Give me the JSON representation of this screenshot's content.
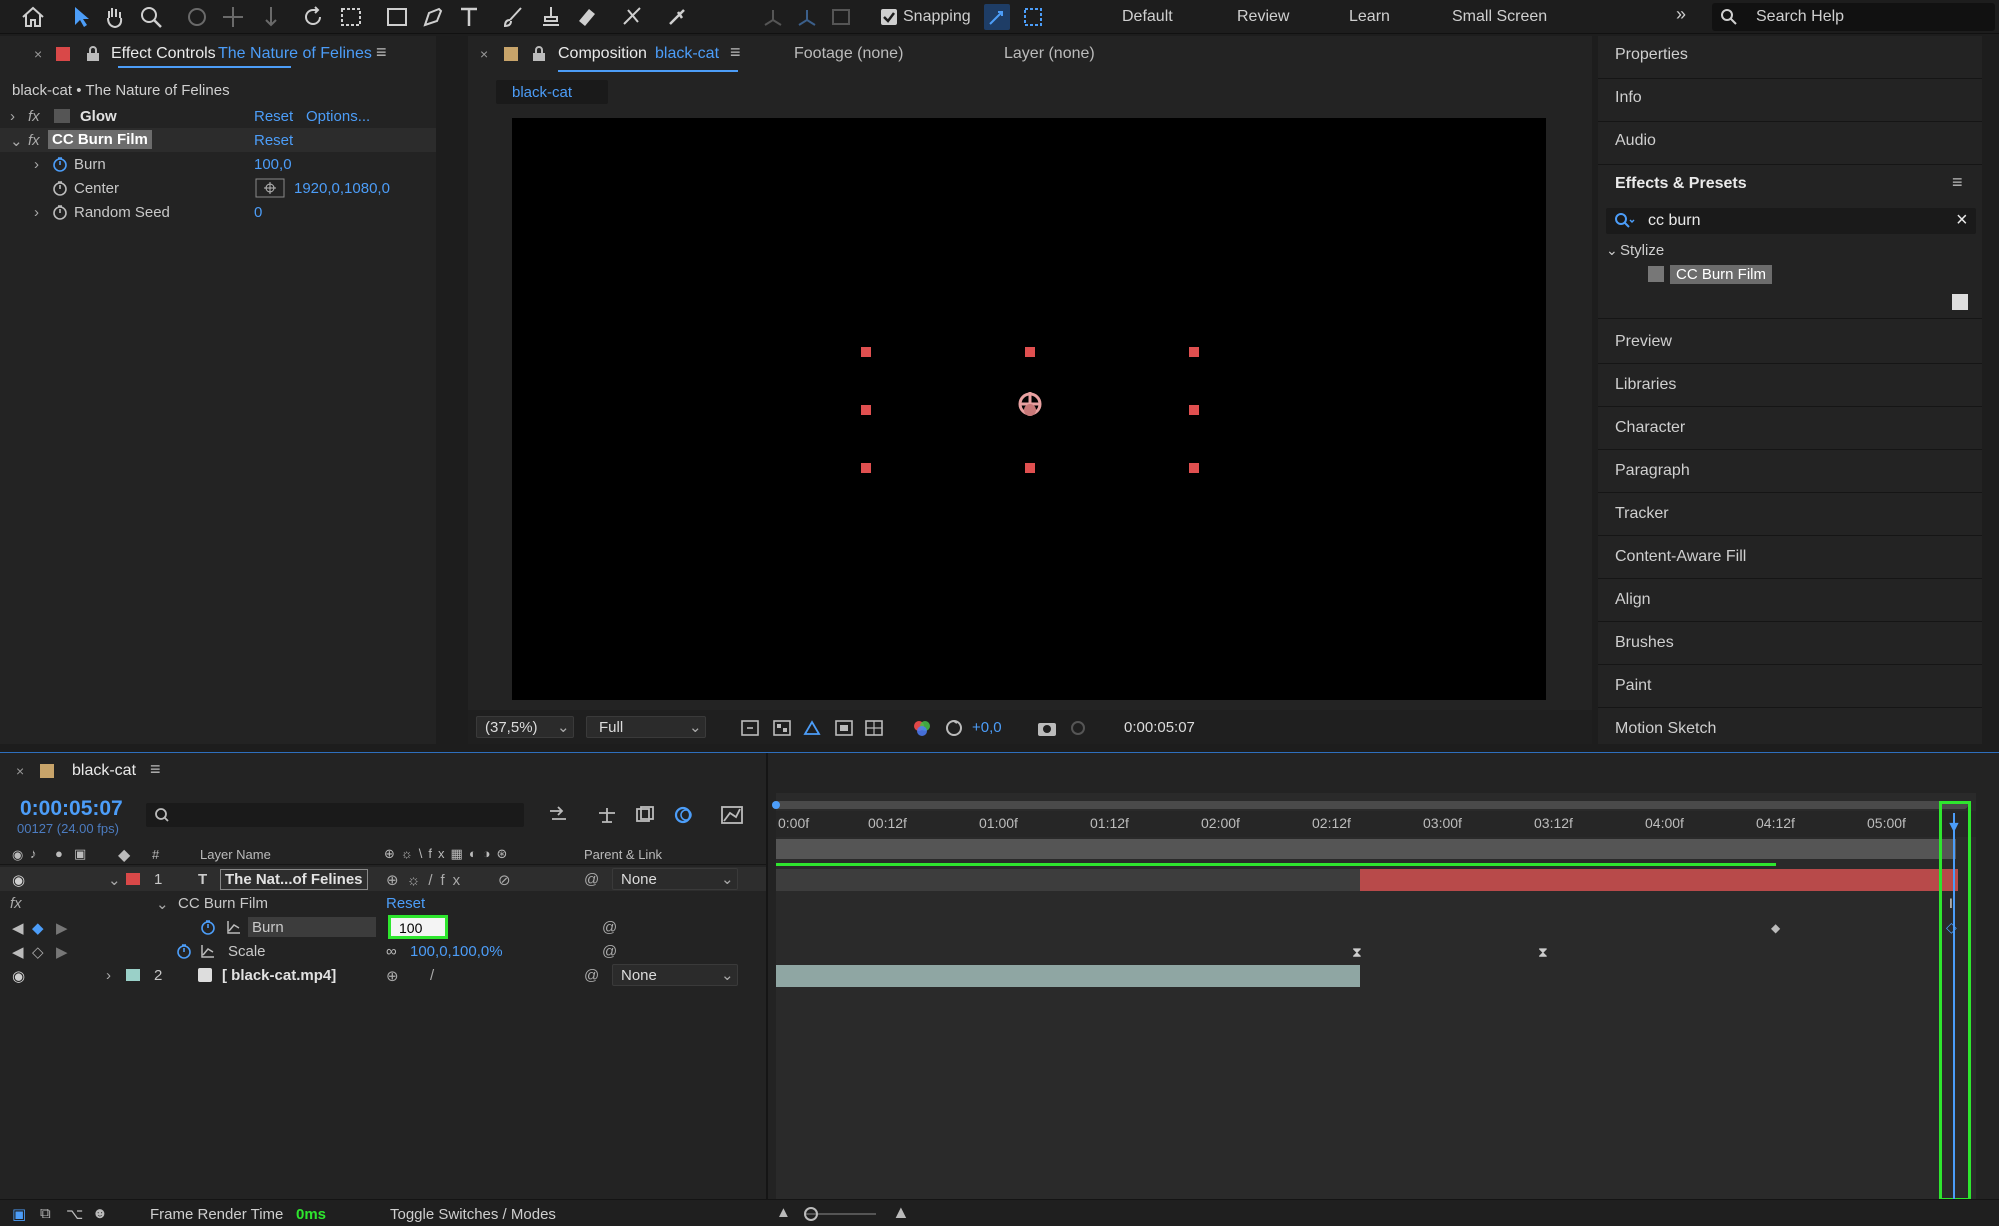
{
  "toolbar": {
    "snapping_label": "Snapping",
    "workspaces": [
      "Default",
      "Review",
      "Learn",
      "Small Screen"
    ],
    "more_label": "»",
    "search_placeholder": "Search Help"
  },
  "effect_controls": {
    "panel_title": "Effect Controls",
    "layer_name": "The Nature of Felines",
    "subtitle": "black-cat • The Nature of Felines",
    "effects": [
      {
        "name": "Glow",
        "reset": "Reset",
        "options": "Options..."
      },
      {
        "name": "CC Burn Film",
        "reset": "Reset"
      }
    ],
    "properties": [
      {
        "name": "Burn",
        "value": "100,0"
      },
      {
        "name": "Center",
        "value": "1920,0,1080,0"
      },
      {
        "name": "Random Seed",
        "value": "0"
      }
    ]
  },
  "composition": {
    "panel_title": "Composition",
    "comp_name": "black-cat",
    "footage_tab": "Footage (none)",
    "layer_tab": "Layer (none)",
    "active_tab": "black-cat",
    "zoom": "(37,5%)",
    "resolution": "Full",
    "exposure": "+0,0",
    "timecode": "0:00:05:07"
  },
  "right_panels": {
    "items_top": [
      "Properties",
      "Info",
      "Audio"
    ],
    "effects_presets": {
      "title": "Effects & Presets",
      "search_value": "cc burn",
      "category": "Stylize",
      "result": "CC Burn Film"
    },
    "items_bottom": [
      "Preview",
      "Libraries",
      "Character",
      "Paragraph",
      "Tracker",
      "Content-Aware Fill",
      "Align",
      "Brushes",
      "Paint",
      "Motion Sketch"
    ]
  },
  "timeline": {
    "comp_name": "black-cat",
    "current_time": "0:00:05:07",
    "frame_info": "00127 (24.00 fps)",
    "columns": {
      "hash": "#",
      "layer_name": "Layer Name",
      "parent_link": "Parent & Link"
    },
    "layers": [
      {
        "num": "1",
        "name": "The Nat...of Felines",
        "parent": "None",
        "label_color": "#d94848"
      },
      {
        "num": "2",
        "name": "[ black-cat.mp4]",
        "parent": "None",
        "label_color": "#9ad0c8"
      }
    ],
    "effect_group": {
      "name": "CC Burn Film",
      "reset": "Reset"
    },
    "burn": {
      "label": "Burn",
      "input_value": "100"
    },
    "scale": {
      "label": "Scale",
      "value": "100,0,100,0%"
    },
    "ruler_ticks": [
      "0:00f",
      "00:12f",
      "01:00f",
      "01:12f",
      "02:00f",
      "02:12f",
      "03:00f",
      "03:12f",
      "04:00f",
      "04:12f",
      "05:00f"
    ],
    "footer": {
      "render_label": "Frame Render Time",
      "render_value": "0ms",
      "toggle_label": "Toggle Switches / Modes"
    },
    "colors": {
      "accent": "#4c9df8",
      "highlight": "#2ee62e",
      "layer1_bar": "#b84a4a",
      "layer2_bar": "#8fa6a3"
    }
  }
}
